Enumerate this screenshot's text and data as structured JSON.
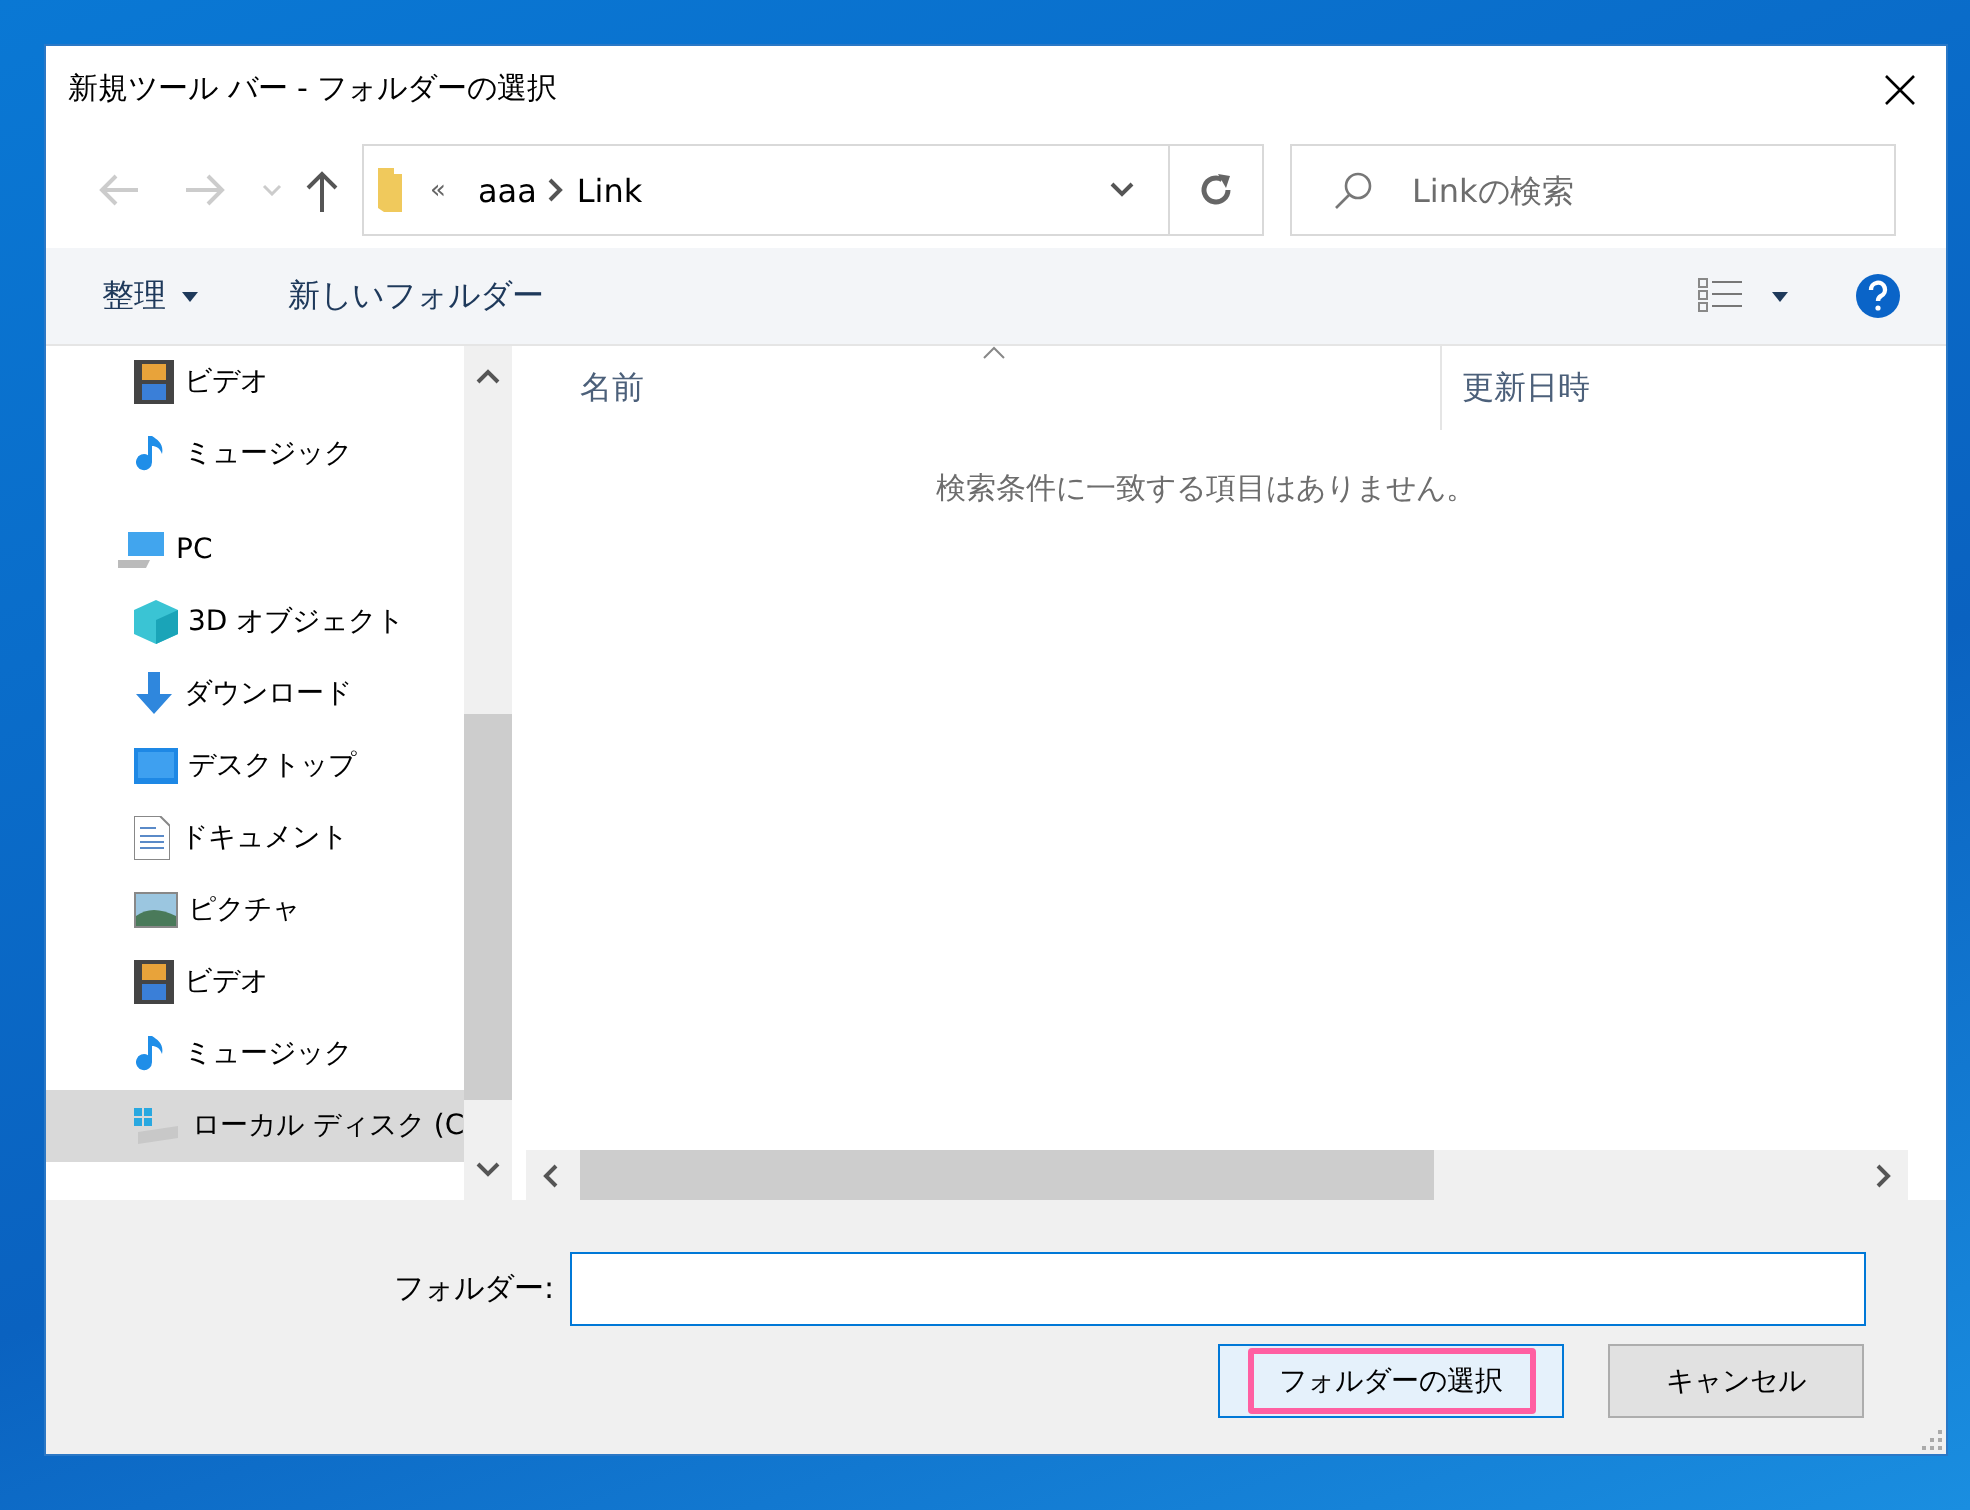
{
  "window": {
    "title": "新規ツール バー - フォルダーの選択"
  },
  "address": {
    "overflow": "«",
    "path": [
      "aaa",
      "Link"
    ]
  },
  "search": {
    "placeholder": "Linkの検索"
  },
  "commands": {
    "organize": "整理",
    "new_folder": "新しいフォルダー"
  },
  "nav_tree": [
    {
      "kind": "group",
      "children": [
        {
          "label": "ビデオ",
          "kind": "video",
          "selected": false
        },
        {
          "label": "ミュージック",
          "kind": "music",
          "selected": false
        }
      ]
    },
    {
      "label": "PC",
      "kind": "pc",
      "selected": false,
      "children": [
        {
          "label": "3D オブジェクト",
          "kind": "cube",
          "selected": false
        },
        {
          "label": "ダウンロード",
          "kind": "download",
          "selected": false
        },
        {
          "label": "デスクトップ",
          "kind": "desktop",
          "selected": false
        },
        {
          "label": "ドキュメント",
          "kind": "document",
          "selected": false
        },
        {
          "label": "ピクチャ",
          "kind": "picture",
          "selected": false
        },
        {
          "label": "ビデオ",
          "kind": "video",
          "selected": false
        },
        {
          "label": "ミュージック",
          "kind": "music",
          "selected": false
        },
        {
          "label": "ローカル ディスク (C",
          "kind": "drive",
          "selected": true
        }
      ]
    }
  ],
  "file_list": {
    "columns": [
      {
        "label": "名前",
        "sorted": true
      },
      {
        "label": "更新日時",
        "sorted": false
      }
    ],
    "empty_message": "検索条件に一致する項目はありません。"
  },
  "folder_field": {
    "label": "フォルダー:"
  },
  "buttons": [
    {
      "label": "フォルダーの選択",
      "kind": "primary",
      "highlighted": true
    },
    {
      "label": "キャンセル",
      "kind": "secondary",
      "highlighted": false
    }
  ]
}
